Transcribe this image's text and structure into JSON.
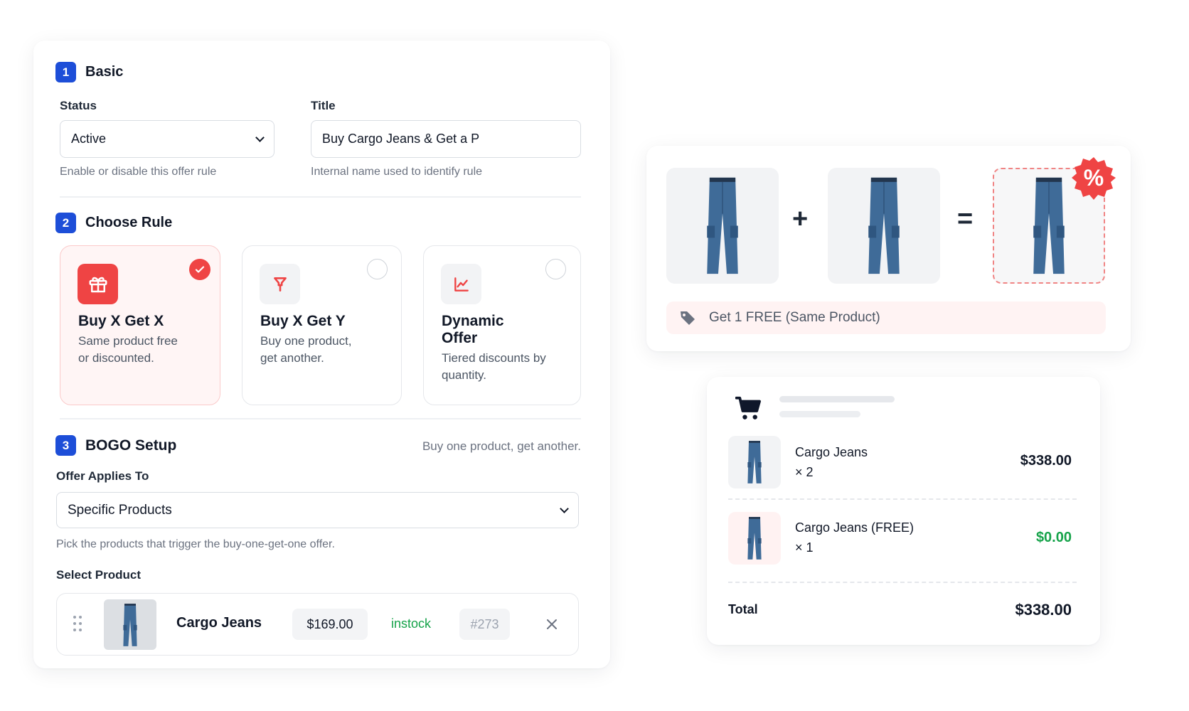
{
  "basic": {
    "step": "1",
    "title": "Basic",
    "status_label": "Status",
    "status_value": "Active",
    "status_hint": "Enable or disable this offer rule",
    "title_label": "Title",
    "title_value": "Buy Cargo Jeans & Get a P",
    "title_hint": "Internal name used to identify rule"
  },
  "choose_rule": {
    "step": "2",
    "title": "Choose Rule",
    "options": [
      {
        "title": "Buy X Get X",
        "desc": "Same product free or discounted.",
        "selected": true,
        "icon": "gift-icon"
      },
      {
        "title": "Buy X Get Y",
        "desc": "Buy one product, get another.",
        "selected": false,
        "icon": "funnel-icon"
      },
      {
        "title": "Dynamic Offer",
        "desc": "Tiered discounts by quantity.",
        "selected": false,
        "icon": "chart-icon"
      }
    ]
  },
  "bogo": {
    "step": "3",
    "title": "BOGO Setup",
    "subtitle": "Buy one product, get another.",
    "applies_label": "Offer Applies To",
    "applies_value": "Specific Products",
    "applies_hint": "Pick the products that trigger the buy-one-get-one offer.",
    "select_label": "Select Product",
    "product": {
      "name": "Cargo Jeans",
      "price": "$169.00",
      "stock": "instock",
      "id": "#273"
    }
  },
  "offer_visual": {
    "plus": "+",
    "equals": "=",
    "badge": "%",
    "offer_text": "Get 1 FREE (Same Product)"
  },
  "cart": {
    "items": [
      {
        "name": "Cargo Jeans",
        "qty": "× 2",
        "price": "$338.00"
      },
      {
        "name": "Cargo Jeans (FREE)",
        "qty": "× 1",
        "price": "$0.00"
      }
    ],
    "total_label": "Total",
    "total_value": "$338.00"
  },
  "colors": {
    "primary_blue": "#1d4ed8",
    "accent_red": "#ef4444",
    "success_green": "#16a34a",
    "selected_bg": "#fff5f5"
  }
}
